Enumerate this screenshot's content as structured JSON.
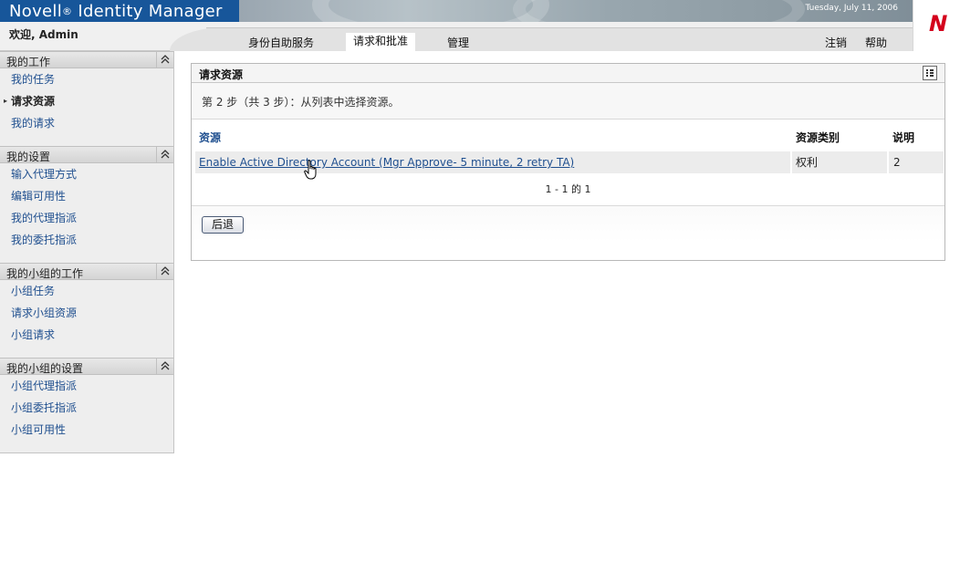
{
  "header": {
    "app_title_left": "Novell",
    "app_title_mark": "®",
    "app_title_right": " Identity Manager",
    "date": "Tuesday, July 11, 2006",
    "welcome": "欢迎, Admin",
    "logo_letter": "N",
    "brand_color": "#d4001c",
    "title_bar_color": "#17569a"
  },
  "tabs": [
    {
      "label": "身份自助服务",
      "active": false
    },
    {
      "label": "请求和批准",
      "active": true
    },
    {
      "label": "管理",
      "active": false
    }
  ],
  "top_links": {
    "logout": "注销",
    "help": "帮助"
  },
  "sidebar": {
    "sections": [
      {
        "title": "我的工作",
        "items": [
          {
            "label": "我的任务",
            "active": false
          },
          {
            "label": "请求资源",
            "active": true
          },
          {
            "label": "我的请求",
            "active": false
          }
        ]
      },
      {
        "title": "我的设置",
        "items": [
          {
            "label": "输入代理方式",
            "active": false
          },
          {
            "label": "编辑可用性",
            "active": false
          },
          {
            "label": "我的代理指派",
            "active": false
          },
          {
            "label": "我的委托指派",
            "active": false
          }
        ]
      },
      {
        "title": "我的小组的工作",
        "items": [
          {
            "label": "小组任务",
            "active": false
          },
          {
            "label": "请求小组资源",
            "active": false
          },
          {
            "label": "小组请求",
            "active": false
          }
        ]
      },
      {
        "title": "我的小组的设置",
        "items": [
          {
            "label": "小组代理指派",
            "active": false
          },
          {
            "label": "小组委托指派",
            "active": false
          },
          {
            "label": "小组可用性",
            "active": false
          }
        ]
      }
    ]
  },
  "panel": {
    "title": "请求资源",
    "step_text": "第 2 步（共 3 步）：从列表中选择资源。",
    "columns": {
      "resource": "资源",
      "category": "资源类别",
      "description": "说明"
    },
    "rows": [
      {
        "resource": "Enable Active Directory Account (Mgr Approve- 5 minute, 2 retry TA)",
        "category": "权利",
        "description": "2"
      }
    ],
    "pager": "1 - 1 的 1",
    "back_button": "后退"
  }
}
